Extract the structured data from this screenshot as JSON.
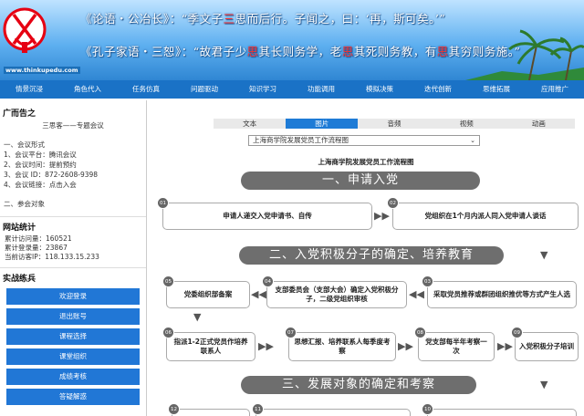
{
  "header": {
    "logo_url": "www.thinkupedu.com",
    "quote1_pre": "《论语・公冶长》：“季文子",
    "quote1_red": "三",
    "quote1_post": "思而后行。子闻之，曰：‘再，斯可矣。’”",
    "quote2_pre": "《孔子家语・三恕》：“故君子少",
    "quote2_red1": "思",
    "quote2_mid1": "其长则务学，老",
    "quote2_red2": "思",
    "quote2_mid2": "其死则务教，有",
    "quote2_red3": "思",
    "quote2_post": "其穷则务施。”"
  },
  "nav": [
    "情景沉浸",
    "角色代入",
    "任务仿真",
    "问题驱动",
    "知识学习",
    "功能调用",
    "模拟决策",
    "迭代创新",
    "思维拓展",
    "应用推广"
  ],
  "sidebar": {
    "ad_title": "广而告之",
    "ad_sub": "三思客——专题会议",
    "ad_lines": [
      "一、会议形式",
      "1、会议平台：腾讯会议",
      "2、会议时间：提前预约",
      "3、会议 ID：872-2608-9398",
      "4、会议链接：点击入会"
    ],
    "ad_extra": "二、参会对象",
    "stats_title": "网站统计",
    "stats": [
      "累计访问量：160521",
      "累计登录量：23867",
      "当前访客IP：118.133.15.233"
    ],
    "practice_title": "实战练兵",
    "practice_buttons": [
      "欢迎登录",
      "退出账号",
      "课程选择",
      "课堂组织",
      "成绩考核",
      "答疑解惑"
    ]
  },
  "content": {
    "tabs": [
      "文本",
      "图片",
      "音频",
      "视频",
      "动画"
    ],
    "active_tab": "图片",
    "select_value": "上海商学院发展党员工作流程图",
    "chart_title": "上海商学院发展党员工作流程图",
    "stage1": "一、申请入党",
    "stage2": "二、入党积极分子的确定、培养教育",
    "stage3": "三、发展对象的确定和考察",
    "steps": {
      "s01": "申请人递交入党申请书、自传",
      "s02": "党组织在1个月内派人同入党申请人谈话",
      "s03": "采取党员推荐或群团组织推优等方式产生人选",
      "s04": "支部委员会（支部大会）确定入党积极分子，二级党组织审核",
      "s05": "党委组织部备案",
      "s06": "指派1-2正式党员作培养联系人",
      "s07": "思想汇报、培养联系人每季度考察",
      "s08": "党支部每半年考察一次",
      "s09": "入党积极分子培训"
    },
    "nums": [
      "01",
      "02",
      "03",
      "04",
      "05",
      "06",
      "07",
      "08",
      "09",
      "10",
      "11",
      "12"
    ]
  }
}
